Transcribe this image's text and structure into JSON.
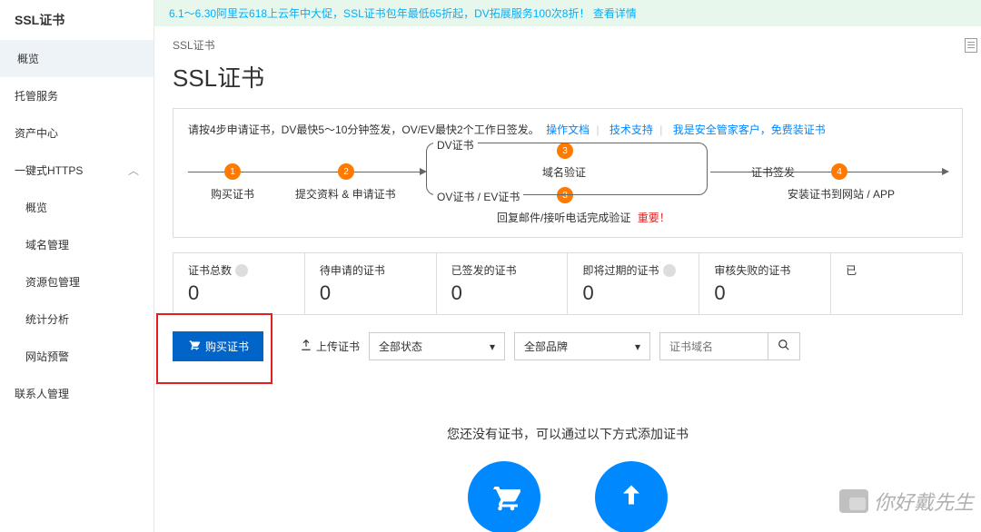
{
  "sidebar": {
    "title": "SSL证书",
    "items": [
      {
        "label": "概览",
        "active": true
      },
      {
        "label": "托管服务"
      },
      {
        "label": "资产中心"
      }
    ],
    "https_group_label": "一键式HTTPS",
    "sub_items": [
      {
        "label": "概览"
      },
      {
        "label": "域名管理"
      },
      {
        "label": "资源包管理"
      },
      {
        "label": "统计分析"
      },
      {
        "label": "网站预警"
      }
    ],
    "contacts_label": "联系人管理"
  },
  "promo": {
    "text": "6.1～6.30阿里云618上云年中大促，SSL证书包年最低65折起，DV拓展服务100次8折！",
    "link": "查看详情"
  },
  "breadcrumb": "SSL证书",
  "page_title": "SSL证书",
  "instruction": {
    "text": "请按4步申请证书，DV最快5～10分钟签发，OV/EV最快2个工作日签发。",
    "links": [
      "操作文档",
      "技术支持",
      "我是安全管家客户，免费装证书"
    ]
  },
  "flow": {
    "step1": "购买证书",
    "step2": "提交资料 & 申请证书",
    "step3_top_branch": "DV证书",
    "step3_bottom_branch": "OV证书 / EV证书",
    "step3_center": "域名验证",
    "step3_bottom_text": "回复邮件/接听电话完成验证",
    "step3_important": "重要！",
    "issue_label": "证书签发",
    "step4": "安装证书到网站 / APP",
    "num1": "1",
    "num2": "2",
    "num3": "3",
    "num4": "4"
  },
  "stats": [
    {
      "label": "证书总数",
      "value": "0",
      "help": true
    },
    {
      "label": "待申请的证书",
      "value": "0"
    },
    {
      "label": "已签发的证书",
      "value": "0"
    },
    {
      "label": "即将过期的证书",
      "value": "0",
      "help": true
    },
    {
      "label": "审核失败的证书",
      "value": "0"
    },
    {
      "label": "已",
      "value": ""
    }
  ],
  "toolbar": {
    "buy_label": "购买证书",
    "upload_label": "上传证书",
    "status_select": "全部状态",
    "brand_select": "全部品牌",
    "search_placeholder": "证书域名"
  },
  "empty_text": "您还没有证书，可以通过以下方式添加证书",
  "watermark": "你好戴先生"
}
